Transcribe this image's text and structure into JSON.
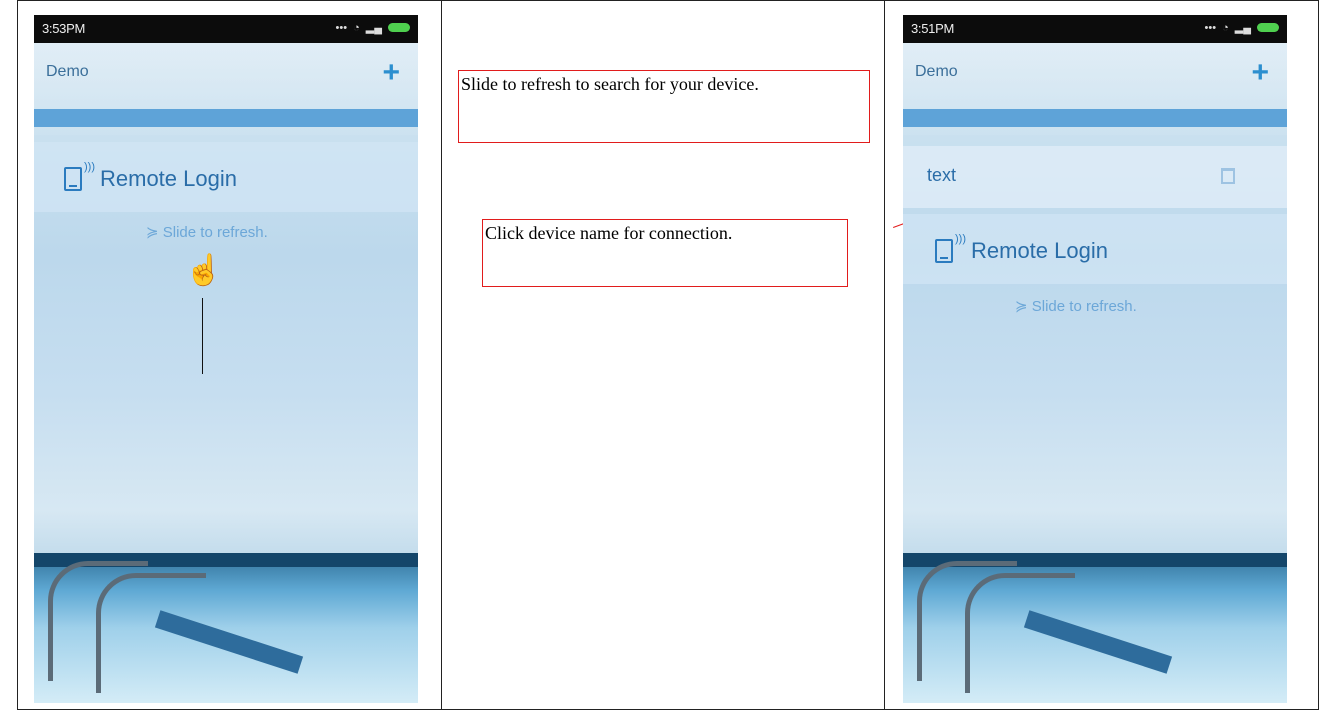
{
  "left_phone": {
    "status_time": "3:53PM",
    "app_title": "Demo",
    "remote_label": "Remote Login",
    "refresh_text": "Slide to refresh."
  },
  "right_phone": {
    "status_time": "3:51PM",
    "app_title": "Demo",
    "device_name": "text",
    "remote_label": "Remote Login",
    "refresh_text": "Slide to refresh."
  },
  "callouts": {
    "refresh_instruction": "Slide to refresh to search for your device.",
    "connect_instruction": "Click device name for connection."
  },
  "icons": {
    "add": "plus-icon",
    "remote": "remote-login-icon",
    "refresh": "double-chevron-down-icon",
    "hand": "pointing-hand-icon",
    "delete": "trash-icon"
  },
  "colors": {
    "accent": "#5ea3d8",
    "callout_border": "#e11c1c",
    "status_bar": "#0c0c0c"
  }
}
